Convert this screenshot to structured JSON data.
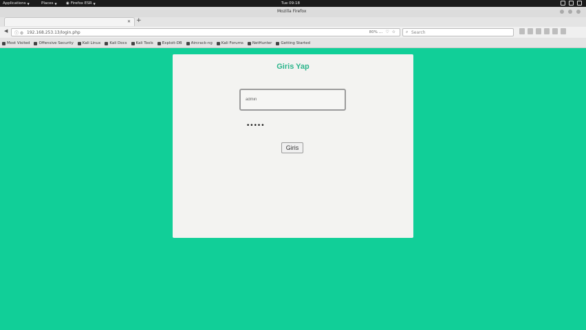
{
  "topbar": {
    "applications": "Applications",
    "places": "Places",
    "browser": "Firefox ESR",
    "clock": "Tue 09:18"
  },
  "browser": {
    "window_title": "Mozilla Firefox",
    "tab_title": "",
    "url": "192.168.253.13/login.php",
    "zoom": "80%",
    "search_placeholder": "Search",
    "bookmarks": [
      {
        "label": "Most Visited",
        "icon": "gear-icon"
      },
      {
        "label": "Offensive Security",
        "icon": "bookmark-icon"
      },
      {
        "label": "Kali Linux",
        "icon": "dragon-icon"
      },
      {
        "label": "Kali Docs",
        "icon": "dragon-icon"
      },
      {
        "label": "Kali Tools",
        "icon": "dragon-icon"
      },
      {
        "label": "Exploit-DB",
        "icon": "exploit-icon"
      },
      {
        "label": "Aircrack-ng",
        "icon": "wifi-icon"
      },
      {
        "label": "Kali Forums",
        "icon": "forum-icon"
      },
      {
        "label": "NetHunter",
        "icon": "dragon-icon"
      },
      {
        "label": "Getting Started",
        "icon": "gear-icon"
      }
    ]
  },
  "login": {
    "title": "Giris Yap",
    "username_value": "admin",
    "password_mask": "•••••",
    "submit_label": "Giris"
  },
  "colors": {
    "page_background": "#11cf98",
    "card_background": "#f3f3f1",
    "title_color": "#2bb58b"
  }
}
